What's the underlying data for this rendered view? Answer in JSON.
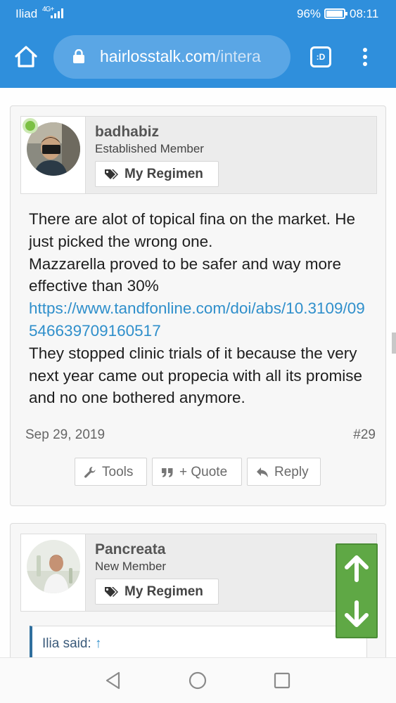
{
  "status": {
    "carrier": "Iliad",
    "network": "4G+",
    "battery_pct": "96%",
    "battery_level": 0.96,
    "time": "08:11"
  },
  "browser": {
    "url_main": "hairlosstalk.com",
    "url_rest": "/intera",
    "tabs_label": ":D",
    "home_icon": "home-icon",
    "lock_icon": "lock-icon",
    "menu_icon": "vertical-dots-icon"
  },
  "posts": [
    {
      "username": "badhabiz",
      "user_title": "Established Member",
      "online": true,
      "regimen_label": "My Regimen",
      "body": {
        "p1": "There are alot of topical fina on the market. He just picked the wrong one.",
        "p2": "Mazzarella proved to be safer and way more effective than 30%",
        "link": "https://www.tandfonline.com/doi/abs/10.3109/09546639709160517",
        "p3": "They stopped clinic trials of it because the very next year came out propecia with all its promise and no one bothered anymore."
      },
      "date": "Sep 29, 2019",
      "number": "#29",
      "actions": {
        "tools": "Tools",
        "quote": "+ Quote",
        "reply": "Reply"
      }
    },
    {
      "username": "Pancreata",
      "user_title": "New Member",
      "regimen_label": "My Regimen",
      "quote_attribution": "Ilia said:",
      "quote_arrow": "↑"
    }
  ],
  "colors": {
    "browser_bar": "#2f8fdc",
    "link": "#2f8fcb",
    "online": "#7bc043",
    "scroll_nav": "#5fa845"
  }
}
